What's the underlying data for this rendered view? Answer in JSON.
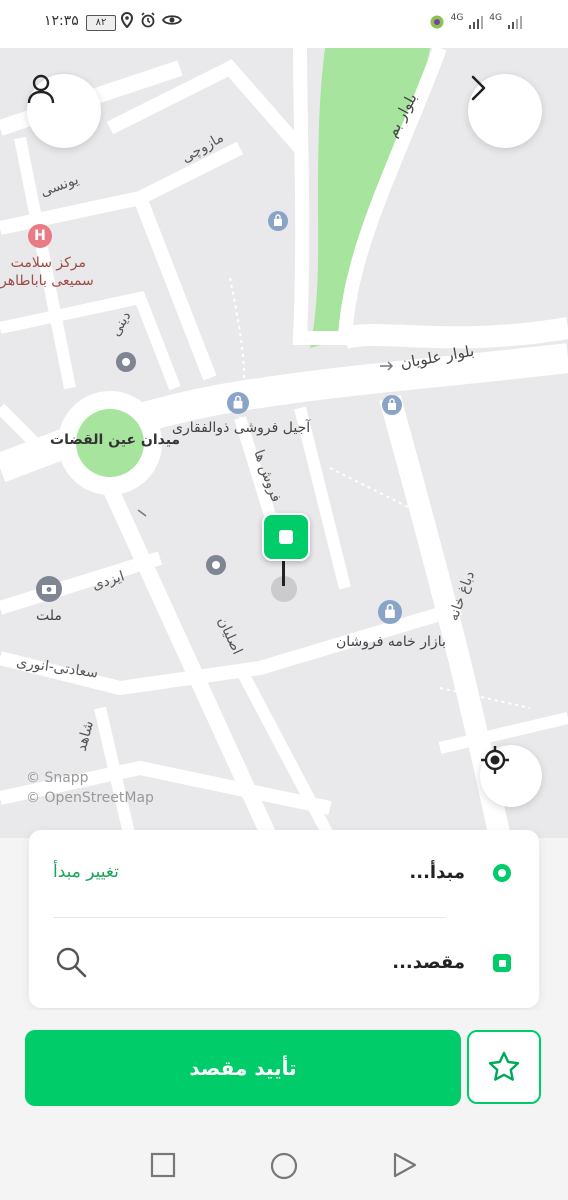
{
  "statusbar": {
    "time": "۱۲:۳۵",
    "battery": "۸۲",
    "net1": "4G",
    "net2": "4G"
  },
  "map": {
    "streets": {
      "boulevard_bam": "بلوار بم",
      "boulevard_alavian": "بلوار علویان",
      "mazuchi": "مازوچی",
      "yunesi": "یونسی",
      "dini": "دینی",
      "fourooshha": "فروش ها",
      "izadi": "ایزدی",
      "esfahan": "اصلیان",
      "saadati_anvari": "سعادتی-انوری",
      "shahed": "شاهد",
      "dabagh_khaneh": "دباغ خانه"
    },
    "places": {
      "square": "میدان عین القضات",
      "hospital_line1": "مرکز سلامت",
      "hospital_line2": "سمیعی باباطاهر",
      "ajil_shop": "آجیل فروشی ذوالفقاری",
      "bank": "ملت",
      "bazaar": "بازار خامه فروشان"
    },
    "credits": {
      "snapp": "© Snapp",
      "osm": "© OpenStreetMap"
    }
  },
  "card": {
    "origin_label": "مبدأ...",
    "change_origin": "تغییر مبدأ",
    "destination_label": "مقصد..."
  },
  "actions": {
    "confirm_destination": "تأیید مقصد"
  },
  "colors": {
    "accent": "#00cc6a",
    "park": "#a7e49d",
    "road": "#ffffff",
    "map_bg": "#e9e9ec"
  }
}
